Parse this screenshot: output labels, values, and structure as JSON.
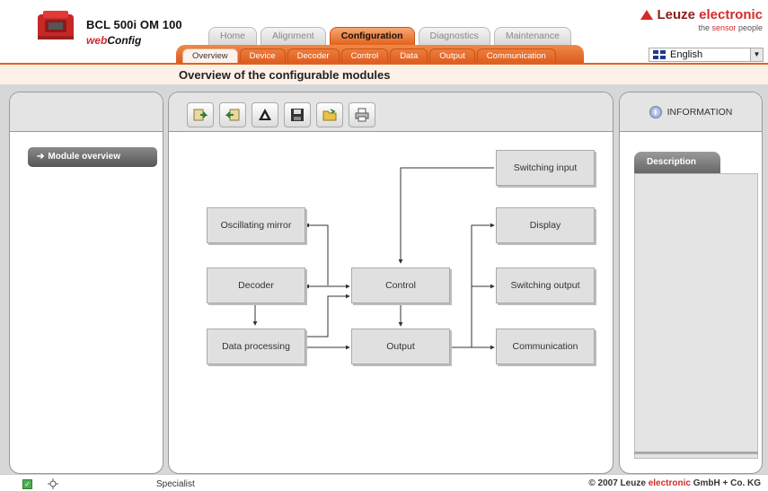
{
  "header": {
    "product_title": "BCL 500i OM 100",
    "subtitle_web": "web",
    "subtitle_config": "Config",
    "logo_prefix": "Leuze ",
    "logo_suffix": "electronic",
    "logo_tag_prefix": "the ",
    "logo_tag_accent": "sensor",
    "logo_tag_suffix": " people",
    "brand_color": "#d32a2a",
    "accent_color": "#e2621c"
  },
  "main_tabs": [
    {
      "label": "Home"
    },
    {
      "label": "Alignment"
    },
    {
      "label": "Configuration",
      "active": true
    },
    {
      "label": "Diagnostics"
    },
    {
      "label": "Maintenance"
    }
  ],
  "sub_tabs": [
    {
      "label": "Overview",
      "active": true
    },
    {
      "label": "Device"
    },
    {
      "label": "Decoder"
    },
    {
      "label": "Control"
    },
    {
      "label": "Data"
    },
    {
      "label": "Output"
    },
    {
      "label": "Communication"
    }
  ],
  "language": {
    "selected": "English",
    "icon": "flag-icon"
  },
  "page": {
    "title": "Overview of the configurable modules"
  },
  "left_panel": {
    "module_overview": "Module overview"
  },
  "toolbar": [
    {
      "name": "upload-to-device-icon"
    },
    {
      "name": "download-from-device-icon"
    },
    {
      "name": "reset-defaults-icon"
    },
    {
      "name": "save-icon"
    },
    {
      "name": "open-folder-icon"
    },
    {
      "name": "print-icon"
    }
  ],
  "diagram": {
    "nodes": {
      "oscillating_mirror": "Oscillating mirror",
      "decoder": "Decoder",
      "data_processing": "Data processing",
      "control": "Control",
      "output": "Output",
      "switching_input": "Switching input",
      "display": "Display",
      "switching_output": "Switching output",
      "communication": "Communication"
    }
  },
  "right_panel": {
    "information": "INFORMATION",
    "description_tab": "Description"
  },
  "status": {
    "role": "Specialist",
    "copyright_prefix": "© 2007 Leuze ",
    "copyright_accent": "electronic",
    "copyright_suffix": " GmbH + Co. KG"
  }
}
